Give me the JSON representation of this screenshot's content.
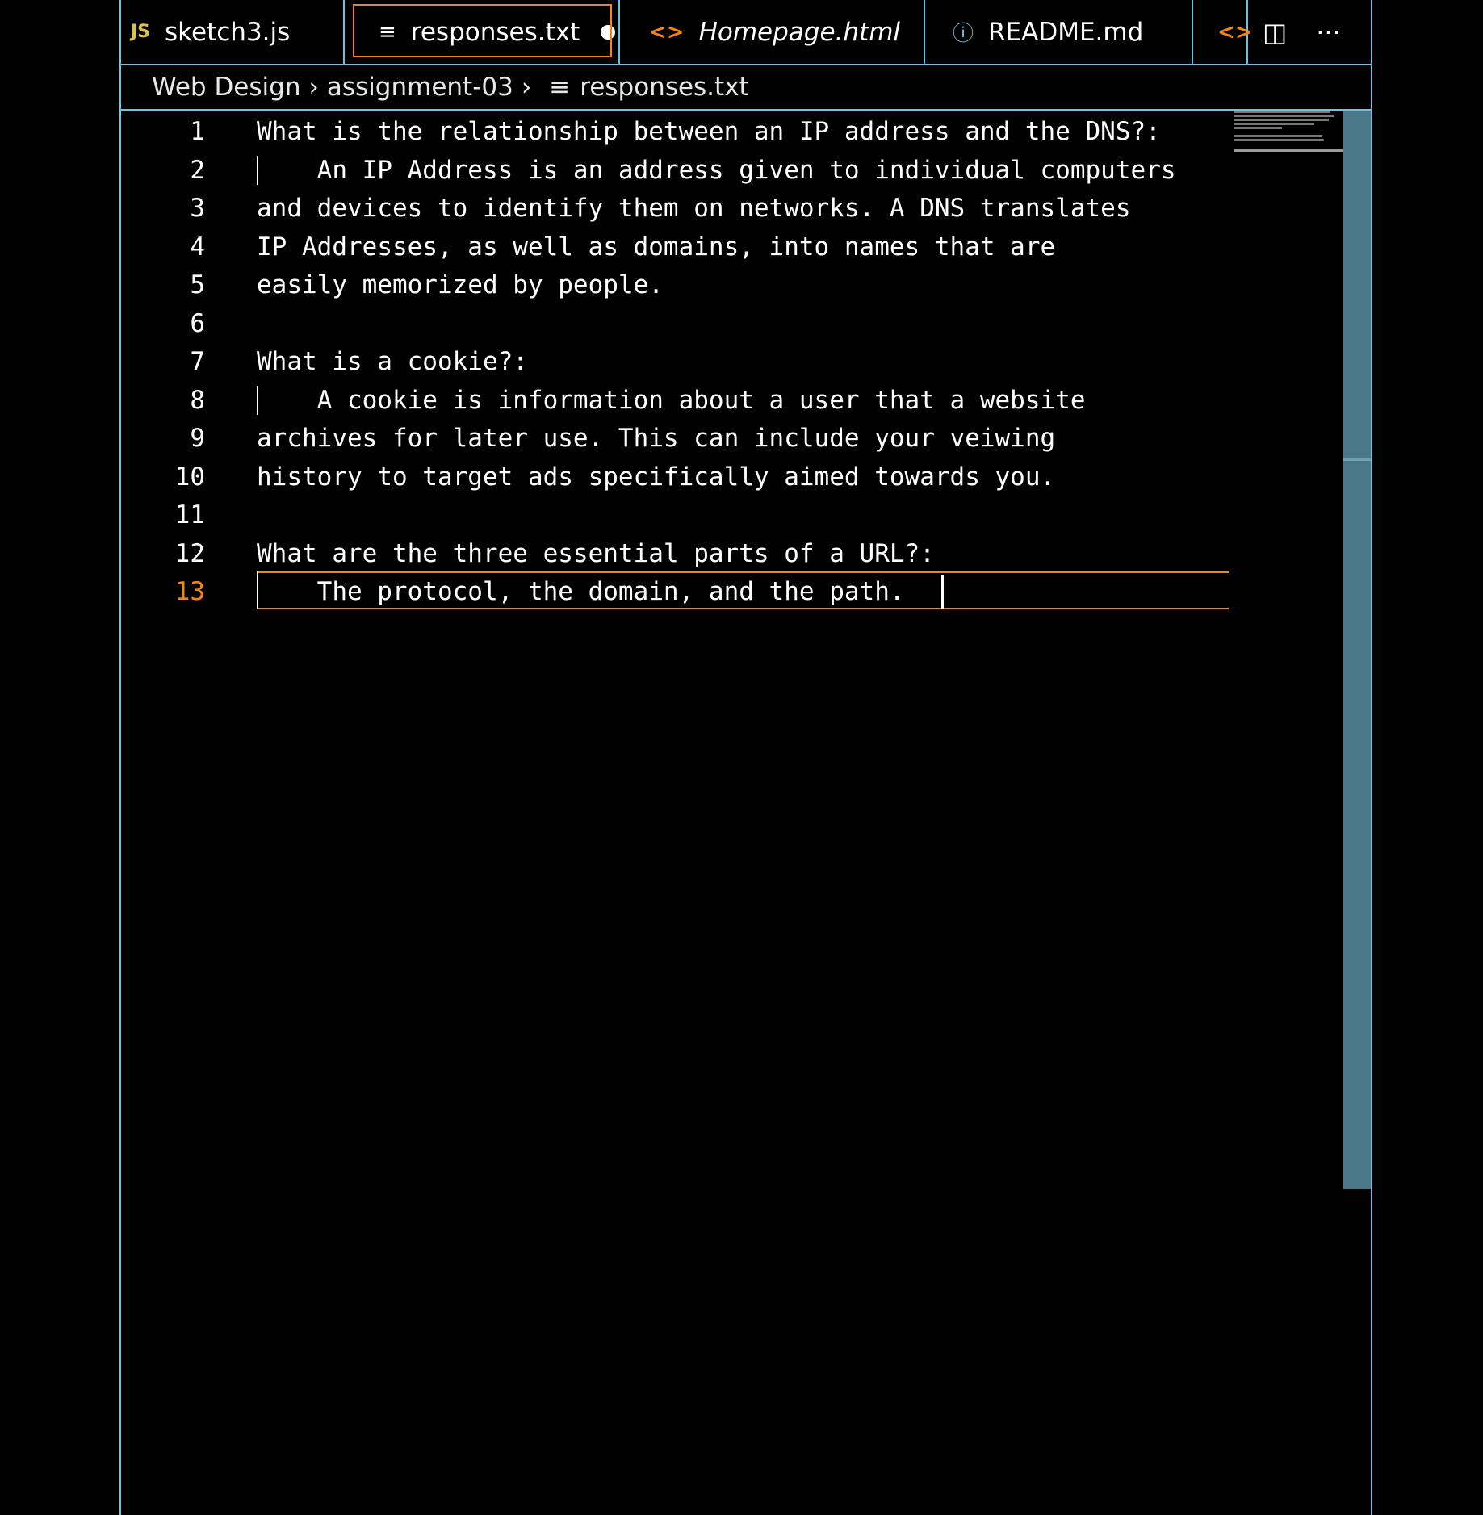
{
  "tabs": [
    {
      "icon": "JS",
      "label": "sketch3.js"
    },
    {
      "icon": "≡",
      "label": "responses.txt",
      "modified": true
    },
    {
      "icon": "<>",
      "label": "Homepage.html"
    },
    {
      "icon": "ⓘ",
      "label": "README.md"
    },
    {
      "icon": "<>",
      "label": ""
    }
  ],
  "actions": {
    "split": "◫",
    "more": "···"
  },
  "breadcrumb": [
    "Web Design",
    "assignment-03",
    "responses.txt"
  ],
  "lines": [
    {
      "n": "1",
      "text": "What is the relationship between an IP address and the DNS?:"
    },
    {
      "n": "2",
      "text": "    An IP Address is an address given to individual computers"
    },
    {
      "n": "3",
      "text": "and devices to identify them on networks. A DNS translates"
    },
    {
      "n": "4",
      "text": "IP Addresses, as well as domains, into names that are"
    },
    {
      "n": "5",
      "text": "easily memorized by people."
    },
    {
      "n": "6",
      "text": ""
    },
    {
      "n": "7",
      "text": "What is a cookie?:"
    },
    {
      "n": "8",
      "text": "    A cookie is information about a user that a website"
    },
    {
      "n": "9",
      "text": "archives for later use. This can include your veiwing"
    },
    {
      "n": "10",
      "text": "history to target ads specifically aimed towards you."
    },
    {
      "n": "11",
      "text": ""
    },
    {
      "n": "12",
      "text": "What are the three essential parts of a URL?:"
    },
    {
      "n": "13",
      "text": "    The protocol, the domain, and the path. "
    }
  ],
  "current_line": "13",
  "colors": {
    "accent": "#f38518",
    "border": "#6fc3df",
    "scrollbar": "#4a7888"
  }
}
